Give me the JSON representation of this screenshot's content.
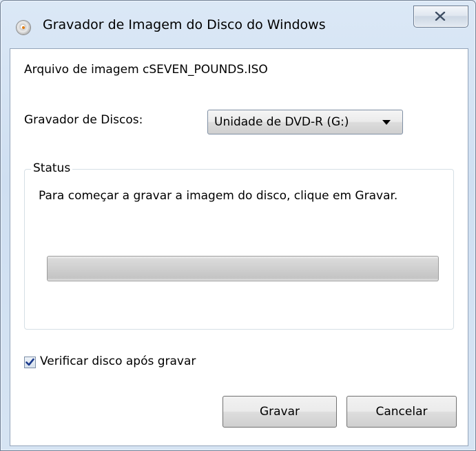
{
  "window": {
    "title": "Gravador de Imagem do Disco do Windows",
    "icon": "disc-burner-icon"
  },
  "titlebar": {
    "close_icon": "close-icon"
  },
  "file": {
    "label": "Arquivo de imagem cSEVEN_POUNDS.ISO"
  },
  "burner": {
    "label": "Gravador de Discos:",
    "selected": "Unidade de DVD-R (G:)"
  },
  "status": {
    "legend": "Status",
    "message": "Para começar a gravar a imagem do disco, clique em Gravar.",
    "progress": 0
  },
  "verify": {
    "checked": true,
    "label": "Verificar disco após gravar"
  },
  "buttons": {
    "burn": "Gravar",
    "cancel": "Cancelar"
  }
}
